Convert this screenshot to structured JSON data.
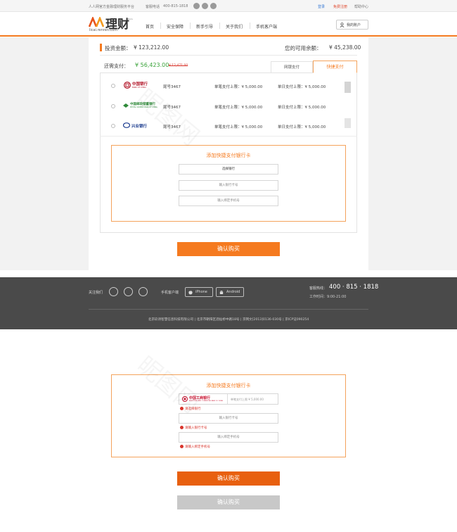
{
  "topbar": {
    "tagline": "人人网官方金融理财服务平台",
    "hotline_label": "客服电话",
    "hotline": "400-815-1818",
    "login": "登录",
    "register": "免费注册",
    "help": "帮助中心"
  },
  "header": {
    "logo_text": "理财",
    "logo_beta": "Beta",
    "logo_sub": "licai.renren.com",
    "nav": [
      "首页",
      "安全保障",
      "新手引导",
      "关于我们",
      "手机客户端"
    ],
    "account": "我的账户"
  },
  "order": {
    "invest_label": "投资金额：",
    "invest_amount": "¥ 123,212.00",
    "balance_label": "您的可用余额：",
    "balance_amount": "¥ 45,238.00",
    "pay_label": "还需支付：",
    "pay_amount": "¥ 56,423.00",
    "pay_original": "¥ 12,471.00",
    "tabs": [
      "网银支付",
      "快捷支付"
    ]
  },
  "banks": [
    {
      "name": "中国银行",
      "en": "BANK OF CHINA",
      "tail": "尾号3467",
      "single": "单笔支付上限：¥ 5,000.00",
      "daily": "单日支付上限：¥ 5,000.00"
    },
    {
      "name": "中国邮政储蓄银行",
      "en": "POSTAL SAVINGS BANK OF CHINA",
      "tail": "尾号3467",
      "single": "单笔支付上限：¥ 5,000.00",
      "daily": "单日支付上限：¥ 5,000.00"
    },
    {
      "name": "兴业银行",
      "en": "",
      "tail": "尾号3467",
      "single": "单笔支付上限：¥ 5,000.00",
      "daily": "单日支付上限：¥ 5,000.00"
    }
  ],
  "add_card": {
    "title": "添加快捷支付银行卡",
    "select_bank": "选择银行",
    "card_placeholder": "输入银行卡号",
    "phone_placeholder": "输入绑定手机号"
  },
  "confirm": "确认购买",
  "footer": {
    "follow": "关注我们",
    "mobile": "手机客户端",
    "iphone": "iPhone",
    "android": "Android",
    "hotline_label": "客服热线：",
    "hotline": "400 · 815 · 1818",
    "hours": "工作时间：9:00-21:00",
    "copyright": "北京玖诗智慧信息科技有限公司 | 北京市朝阳区酒仙桥中路18号 | 京网文[2013]0136-030号 | 京ICP证090254"
  },
  "error_state": {
    "title": "添加快捷支付银行卡",
    "bank_name": "中国工商银行",
    "bank_en": "INDUSTRIAL AND COMMERCIAL BANK OF CHINA",
    "bank_limit": "单笔支付上限 ¥ 5,000.00",
    "err_bank": "请选择银行",
    "card_placeholder": "输入银行卡号",
    "err_card": "请输入银行卡号",
    "phone_placeholder": "输入绑定手机号",
    "err_phone": "请输入绑定手机号",
    "confirm": "确认购买",
    "confirm_disabled": "确认购买"
  },
  "watermark": [
    "昵图网",
    "昵图网"
  ],
  "colors": {
    "accent": "#f57a1f",
    "green": "#3aa33a",
    "red": "#d9342b",
    "footer": "#4a4a4a"
  }
}
